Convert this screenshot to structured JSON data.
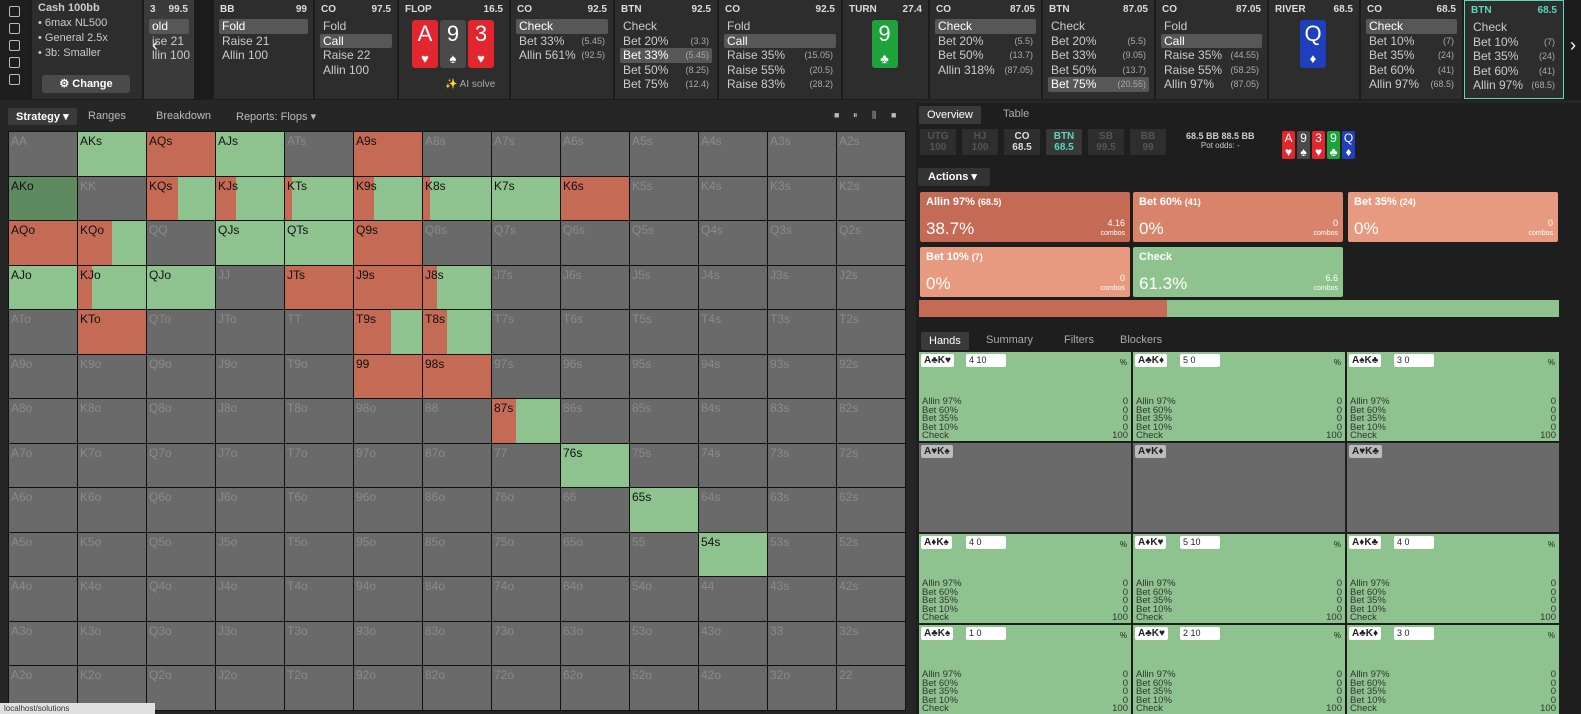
{
  "top": {
    "sidebar_icons": [
      "bookmark-icon",
      "undo-icon",
      "save-icon",
      "gamepad-icon",
      "clipboard-icon"
    ],
    "info": {
      "title": "Cash 100bb",
      "lines": [
        "• 6max NL500",
        "• General 2.5x",
        "• 3b: Smaller"
      ],
      "change": "⚙ Change"
    },
    "prev_stub": {
      "pos": "3",
      "stack": "99.5",
      "rows": [
        "old",
        "ise 21",
        "llin 100"
      ]
    },
    "cols": [
      {
        "pos": "BB",
        "stack": "99",
        "rows": [
          {
            "t": "Fold",
            "sel": true
          },
          {
            "t": "Raise 21"
          },
          {
            "t": "Allin 100"
          }
        ]
      },
      {
        "pos": "CO",
        "stack": "97.5",
        "rows": [
          {
            "t": "Fold"
          },
          {
            "t": "Call",
            "sel": true
          },
          {
            "t": "Raise 22"
          },
          {
            "t": "Allin 100"
          }
        ]
      },
      {
        "pos": "CO",
        "stack": "92.5",
        "rows": [
          {
            "t": "Check",
            "sel": true
          },
          {
            "t": "Bet 33%",
            "ev": "(5.45)"
          },
          {
            "t": "Allin 561%",
            "ev": "(92.5)"
          }
        ]
      },
      {
        "pos": "BTN",
        "stack": "92.5",
        "rows": [
          {
            "t": "Check"
          },
          {
            "t": "Bet 20%",
            "ev": "(3.3)"
          },
          {
            "t": "Bet 33%",
            "ev": "(5.45)",
            "sel": true
          },
          {
            "t": "Bet 50%",
            "ev": "(8.25)"
          },
          {
            "t": "Bet 75%",
            "ev": "(12.4)"
          }
        ]
      },
      {
        "pos": "CO",
        "stack": "92.5",
        "rows": [
          {
            "t": "Fold"
          },
          {
            "t": "Call",
            "sel": true
          },
          {
            "t": "Raise 35%",
            "ev": "(15.05)"
          },
          {
            "t": "Raise 55%",
            "ev": "(20.5)"
          },
          {
            "t": "Raise 83%",
            "ev": "(28.2)"
          }
        ]
      },
      {
        "pos": "CO",
        "stack": "87.05",
        "rows": [
          {
            "t": "Check",
            "sel": true
          },
          {
            "t": "Bet 20%",
            "ev": "(5.5)"
          },
          {
            "t": "Bet 50%",
            "ev": "(13.7)"
          },
          {
            "t": "Allin 318%",
            "ev": "(87.05)"
          }
        ]
      },
      {
        "pos": "BTN",
        "stack": "87.05",
        "rows": [
          {
            "t": "Check"
          },
          {
            "t": "Bet 20%",
            "ev": "(5.5)"
          },
          {
            "t": "Bet 33%",
            "ev": "(9.05)"
          },
          {
            "t": "Bet 50%",
            "ev": "(13.7)"
          },
          {
            "t": "Bet 75%",
            "ev": "(20.55)",
            "sel": true
          }
        ]
      },
      {
        "pos": "CO",
        "stack": "87.05",
        "rows": [
          {
            "t": "Fold"
          },
          {
            "t": "Call",
            "sel": true
          },
          {
            "t": "Raise 35%",
            "ev": "(44.55)"
          },
          {
            "t": "Raise 55%",
            "ev": "(58.25)"
          },
          {
            "t": "Allin 97%",
            "ev": "(87.05)"
          }
        ]
      },
      {
        "pos": "CO",
        "stack": "68.5",
        "rows": [
          {
            "t": "Check",
            "sel": true
          },
          {
            "t": "Bet 10%",
            "ev": "(7)"
          },
          {
            "t": "Bet 35%",
            "ev": "(24)"
          },
          {
            "t": "Bet 60%",
            "ev": "(41)"
          },
          {
            "t": "Allin 97%",
            "ev": "(68.5)"
          }
        ]
      },
      {
        "pos": "BTN",
        "stack": "68.5",
        "rows": [
          {
            "t": "Check"
          },
          {
            "t": "Bet 10%",
            "ev": "(7)"
          },
          {
            "t": "Bet 35%",
            "ev": "(24)"
          },
          {
            "t": "Bet 60%",
            "ev": "(41)"
          },
          {
            "t": "Allin 97%",
            "ev": "(68.5)"
          }
        ]
      }
    ],
    "flop": {
      "label": "FLOP",
      "pot": "16.5",
      "cards": [
        {
          "r": "A",
          "s": "♥",
          "c": "red"
        },
        {
          "r": "9",
          "s": "♠",
          "c": "grey"
        },
        {
          "r": "3",
          "s": "♥",
          "c": "red"
        }
      ],
      "ai": "✨ AI solve"
    },
    "turn": {
      "label": "TURN",
      "pot": "27.4",
      "card": {
        "r": "9",
        "s": "♣",
        "c": "green"
      }
    },
    "river": {
      "label": "RIVER",
      "pot": "68.5",
      "card": {
        "r": "Q",
        "s": "♦",
        "c": "blue"
      }
    }
  },
  "left": {
    "tabs": [
      "Strategy ▾",
      "Ranges",
      "Breakdown",
      "Reports: Flops ▾"
    ],
    "grid": [
      [
        "AA",
        "AKs",
        "AQs",
        "AJs",
        "ATs",
        "A9s",
        "A8s",
        "A7s",
        "A6s",
        "A5s",
        "A4s",
        "A3s",
        "A2s"
      ],
      [
        "AKo",
        "KK",
        "KQs",
        "KJs",
        "KTs",
        "K9s",
        "K8s",
        "K7s",
        "K6s",
        "K5s",
        "K4s",
        "K3s",
        "K2s"
      ],
      [
        "AQo",
        "KQo",
        "QQ",
        "QJs",
        "QTs",
        "Q9s",
        "Q8s",
        "Q7s",
        "Q6s",
        "Q5s",
        "Q4s",
        "Q3s",
        "Q2s"
      ],
      [
        "AJo",
        "KJo",
        "QJo",
        "JJ",
        "JTs",
        "J9s",
        "J8s",
        "J7s",
        "J6s",
        "J5s",
        "J4s",
        "J3s",
        "J2s"
      ],
      [
        "ATo",
        "KTo",
        "QTo",
        "JTo",
        "TT",
        "T9s",
        "T8s",
        "T7s",
        "T6s",
        "T5s",
        "T4s",
        "T3s",
        "T2s"
      ],
      [
        "A9o",
        "K9o",
        "Q9o",
        "J9o",
        "T9o",
        "99",
        "98s",
        "97s",
        "96s",
        "95s",
        "94s",
        "93s",
        "92s"
      ],
      [
        "A8o",
        "K8o",
        "Q8o",
        "J8o",
        "T8o",
        "98o",
        "88",
        "87s",
        "86s",
        "85s",
        "84s",
        "83s",
        "82s"
      ],
      [
        "A7o",
        "K7o",
        "Q7o",
        "J7o",
        "T7o",
        "97o",
        "87o",
        "77",
        "76s",
        "75s",
        "74s",
        "73s",
        "72s"
      ],
      [
        "A6o",
        "K6o",
        "Q6o",
        "J6o",
        "T6o",
        "96o",
        "86o",
        "76o",
        "66",
        "65s",
        "64s",
        "63s",
        "62s"
      ],
      [
        "A5o",
        "K5o",
        "Q5o",
        "J5o",
        "T5o",
        "95o",
        "85o",
        "75o",
        "65o",
        "55",
        "54s",
        "53s",
        "52s"
      ],
      [
        "A4o",
        "K4o",
        "Q4o",
        "J4o",
        "T4o",
        "94o",
        "84o",
        "74o",
        "64o",
        "54o",
        "44",
        "43s",
        "42s"
      ],
      [
        "A3o",
        "K3o",
        "Q3o",
        "J3o",
        "T3o",
        "93o",
        "83o",
        "73o",
        "63o",
        "53o",
        "43o",
        "33",
        "32s"
      ],
      [
        "A2o",
        "K2o",
        "Q2o",
        "J2o",
        "T2o",
        "92o",
        "82o",
        "72o",
        "62o",
        "52o",
        "42o",
        "32o",
        "22"
      ]
    ],
    "strat": {
      "AKs": 0,
      "AQs": 1,
      "AJs": 0,
      "A9s": 1,
      "AKo": -1,
      "KQs": 0.45,
      "KJs": 0.3,
      "KTs": 0.1,
      "K9s": 0.3,
      "K8s": 0.1,
      "K7s": 0,
      "K6s": 1,
      "AQo": 1,
      "KQo": 0.5,
      "QJs": 0,
      "QTs": 0,
      "Q9s": 1,
      "AJo": 0,
      "KJo": 0.2,
      "QJo": 0,
      "JTs": 1,
      "J9s": 1,
      "J8s": 0.2,
      "KTo": 1,
      "T9s": 0.55,
      "T8s": 0.35,
      "99": 1,
      "98s": 1,
      "87s": 0.35,
      "76s": 0,
      "65s": 0,
      "54s": 0
    }
  },
  "right": {
    "tabs": [
      "Overview",
      "Table"
    ],
    "positions": [
      {
        "p": "UTG",
        "s": "100"
      },
      {
        "p": "HJ",
        "s": "100"
      },
      {
        "p": "CO",
        "s": "68.5"
      },
      {
        "p": "BTN",
        "s": "68.5"
      },
      {
        "p": "SB",
        "s": "99.5"
      },
      {
        "p": "BB",
        "s": "99"
      }
    ],
    "pot_line1": "68.5 BB  88.5 BB",
    "pot_line2": "Pot odds:  -",
    "board": [
      {
        "r": "A",
        "s": "♥",
        "c": "red"
      },
      {
        "r": "9",
        "s": "♠",
        "c": "grey"
      },
      {
        "r": "3",
        "s": "♥",
        "c": "red"
      },
      {
        "r": "9",
        "s": "♣",
        "c": "green"
      },
      {
        "r": "Q",
        "s": "♦",
        "c": "blue"
      }
    ],
    "actions_label": "Actions ▾",
    "action_boxes": [
      {
        "name": "Allin 97%",
        "size": "(68.5)",
        "pct": "38.7%",
        "combos": "4.16",
        "color": "#c46a55"
      },
      {
        "name": "Bet 60%",
        "size": "(41)",
        "pct": "0%",
        "combos": "0",
        "color": "#d9846a"
      },
      {
        "name": "Bet 35%",
        "size": "(24)",
        "pct": "0%",
        "combos": "0",
        "color": "#e89a80"
      },
      {
        "name": "Bet 10%",
        "size": "(7)",
        "pct": "0%",
        "combos": "0",
        "color": "#e89a80"
      },
      {
        "name": "Check",
        "size": "",
        "pct": "61.3%",
        "combos": "6.6",
        "color": "#8ec28e"
      }
    ],
    "combos_label": "combos",
    "freq_red": 0.387,
    "hand_tabs": [
      "Hands",
      "Summary",
      "Filters",
      "Blockers"
    ],
    "hands": [
      {
        "c": "A♣K♥",
        "b": "4  10",
        "dim": false,
        "vals": [
          "0",
          "0",
          "0",
          "0",
          "100"
        ]
      },
      {
        "c": "A♣K♦",
        "b": "5  0",
        "dim": false,
        "vals": [
          "0",
          "0",
          "0",
          "0",
          "100"
        ]
      },
      {
        "c": "A♠K♣",
        "b": "3  0",
        "dim": false,
        "vals": [
          "0",
          "0",
          "0",
          "0",
          "100"
        ]
      },
      {
        "c": "A♥K♠",
        "b": "",
        "dim": true,
        "vals": []
      },
      {
        "c": "A♥K♦",
        "b": "",
        "dim": true,
        "vals": []
      },
      {
        "c": "A♥K♣",
        "b": "",
        "dim": true,
        "vals": []
      },
      {
        "c": "A♦K♠",
        "b": "4  0",
        "dim": false,
        "vals": [
          "0",
          "0",
          "0",
          "0",
          "100"
        ]
      },
      {
        "c": "A♦K♥",
        "b": "5  10",
        "dim": false,
        "vals": [
          "0",
          "0",
          "0",
          "0",
          "100"
        ]
      },
      {
        "c": "A♦K♣",
        "b": "4  0",
        "dim": false,
        "vals": [
          "0",
          "0",
          "0",
          "0",
          "100"
        ]
      },
      {
        "c": "A♣K♠",
        "b": "1  0",
        "dim": false,
        "vals": [
          "0",
          "0",
          "0",
          "0",
          "100"
        ]
      },
      {
        "c": "A♣K♥",
        "b": "2  10",
        "dim": false,
        "vals": [
          "0",
          "0",
          "0",
          "0",
          "100"
        ]
      },
      {
        "c": "A♣K♦",
        "b": "3  0",
        "dim": false,
        "vals": [
          "0",
          "0",
          "0",
          "0",
          "100"
        ]
      }
    ],
    "line_names": [
      "Allin 97%",
      "Bet 60%",
      "Bet 35%",
      "Bet 10%",
      "Check"
    ],
    "pct_sign": "%"
  },
  "footer": "localhost/solutions"
}
